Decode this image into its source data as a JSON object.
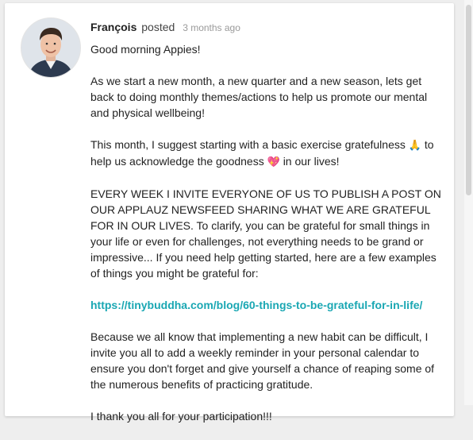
{
  "post": {
    "author": "François",
    "action": "posted",
    "time": "3 months ago",
    "greeting": "Good morning Appies!",
    "p1": "As we start a new month, a new quarter and a new season, lets get back to doing monthly themes/actions to help us promote our mental and physical wellbeing!",
    "p2_part1": "This month, I suggest starting with a basic exercise gratefulness",
    "p2_emoji1": "🙏",
    "p2_part2": "to help us acknowledge the goodness",
    "p2_emoji2": "💖",
    "p2_part3": "in our lives!",
    "p3": "EVERY WEEK I INVITE EVERYONE OF US TO PUBLISH A POST ON OUR APPLAUZ NEWSFEED SHARING WHAT WE ARE GRATEFUL FOR IN OUR LIVES. To clarify, you can be grateful for small things in your life or even for challenges, not everything needs to be grand or impressive... If you need help getting started, here are a few examples of things you might be grateful for:",
    "link": "https://tinybuddha.com/blog/60-things-to-be-grateful-for-in-life/",
    "p4": "Because we all know that implementing a new habit can be difficult, I invite you all to add a weekly reminder in your personal calendar to ensure you don't forget and give yourself a chance of reaping some of the numerous benefits of practicing gratitude.",
    "p5": "I thank you all for your participation!!!"
  },
  "colors": {
    "link": "#1aa7b3",
    "text": "#222222",
    "muted": "#9a9a9a"
  }
}
